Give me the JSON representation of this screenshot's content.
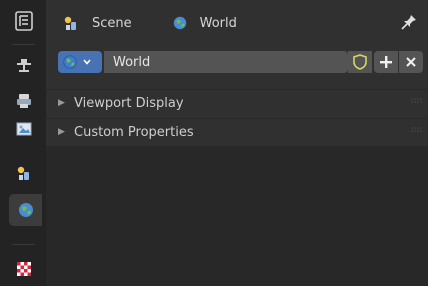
{
  "header": {
    "scene_label": "Scene",
    "world_label": "World"
  },
  "datablock": {
    "name": "World"
  },
  "panels": [
    {
      "label": "Viewport Display"
    },
    {
      "label": "Custom Properties"
    }
  ],
  "tabs": [
    {
      "name": "tool-tab",
      "active": false
    },
    {
      "name": "render-tab",
      "active": false
    },
    {
      "name": "output-tab",
      "active": false
    },
    {
      "name": "view-layer-tab",
      "active": false
    },
    {
      "name": "scene-tab",
      "active": false
    },
    {
      "name": "world-tab",
      "active": true
    },
    {
      "name": "texture-tab",
      "active": false
    }
  ],
  "colors": {
    "accent": "#4772b3",
    "background": "#303030",
    "tab_strip": "#232323"
  }
}
